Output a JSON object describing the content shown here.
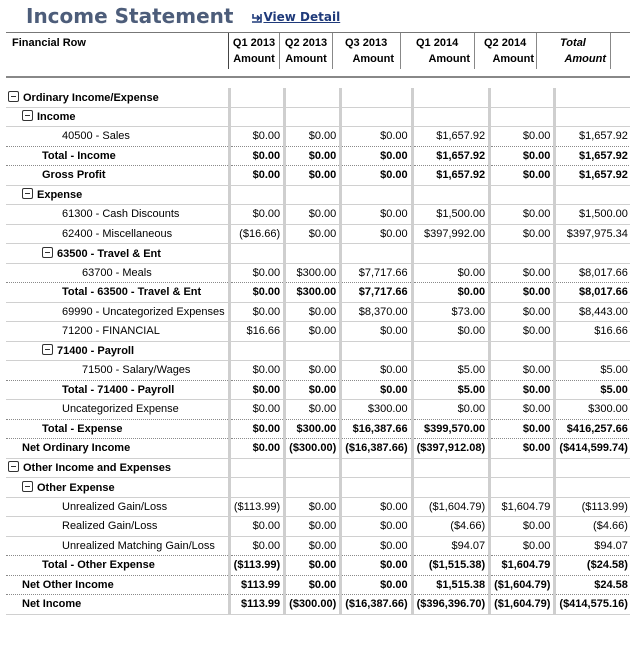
{
  "page": {
    "title": "Income Statement",
    "view_detail": "View Detail",
    "view_detail_icon": "return-arrow-icon"
  },
  "header": {
    "row_label": "Financial Row",
    "columns": [
      {
        "period": "Q1 2013",
        "sub": "Amount"
      },
      {
        "period": "Q2 2013",
        "sub": "Amount"
      },
      {
        "period": "Q3 2013",
        "sub": "Amount"
      },
      {
        "period": "Q1 2014",
        "sub": "Amount"
      },
      {
        "period": "Q2 2014",
        "sub": "Amount"
      },
      {
        "period": "Total",
        "sub": "Amount"
      }
    ]
  },
  "rows": [
    {
      "label": "Ordinary Income/Expense",
      "indent": 0,
      "type": "section",
      "collapsible": true,
      "values": [
        "",
        "",
        "",
        "",
        "",
        ""
      ]
    },
    {
      "label": "Income",
      "indent": 1,
      "type": "section",
      "collapsible": true,
      "values": [
        "",
        "",
        "",
        "",
        "",
        ""
      ]
    },
    {
      "label": "40500 - Sales",
      "indent": 3,
      "type": "item",
      "values": [
        "$0.00",
        "$0.00",
        "$0.00",
        "$1,657.92",
        "$0.00",
        "$1,657.92"
      ]
    },
    {
      "label": "Total - Income",
      "indent": 2,
      "type": "total",
      "values": [
        "$0.00",
        "$0.00",
        "$0.00",
        "$1,657.92",
        "$0.00",
        "$1,657.92"
      ]
    },
    {
      "label": "Gross Profit",
      "indent": 2,
      "type": "total",
      "values": [
        "$0.00",
        "$0.00",
        "$0.00",
        "$1,657.92",
        "$0.00",
        "$1,657.92"
      ]
    },
    {
      "label": "Expense",
      "indent": 1,
      "type": "section",
      "collapsible": true,
      "values": [
        "",
        "",
        "",
        "",
        "",
        ""
      ]
    },
    {
      "label": "61300 - Cash Discounts",
      "indent": 3,
      "type": "item",
      "values": [
        "$0.00",
        "$0.00",
        "$0.00",
        "$1,500.00",
        "$0.00",
        "$1,500.00"
      ]
    },
    {
      "label": "62400 - Miscellaneous",
      "indent": 3,
      "type": "item",
      "values": [
        "($16.66)",
        "$0.00",
        "$0.00",
        "$397,992.00",
        "$0.00",
        "$397,975.34"
      ]
    },
    {
      "label": "63500 - Travel & Ent",
      "indent": 2,
      "type": "section",
      "collapsible": true,
      "values": [
        "",
        "",
        "",
        "",
        "",
        ""
      ]
    },
    {
      "label": "63700 - Meals",
      "indent": 4,
      "type": "item",
      "values": [
        "$0.00",
        "$300.00",
        "$7,717.66",
        "$0.00",
        "$0.00",
        "$8,017.66"
      ]
    },
    {
      "label": "Total - 63500 - Travel & Ent",
      "indent": 3,
      "type": "total",
      "values": [
        "$0.00",
        "$300.00",
        "$7,717.66",
        "$0.00",
        "$0.00",
        "$8,017.66"
      ]
    },
    {
      "label": "69990 - Uncategorized Expenses",
      "indent": 3,
      "type": "item",
      "values": [
        "$0.00",
        "$0.00",
        "$8,370.00",
        "$73.00",
        "$0.00",
        "$8,443.00"
      ]
    },
    {
      "label": "71200 - FINANCIAL",
      "indent": 3,
      "type": "item",
      "values": [
        "$16.66",
        "$0.00",
        "$0.00",
        "$0.00",
        "$0.00",
        "$16.66"
      ]
    },
    {
      "label": "71400 - Payroll",
      "indent": 2,
      "type": "section",
      "collapsible": true,
      "values": [
        "",
        "",
        "",
        "",
        "",
        ""
      ]
    },
    {
      "label": "71500 - Salary/Wages",
      "indent": 4,
      "type": "item",
      "values": [
        "$0.00",
        "$0.00",
        "$0.00",
        "$5.00",
        "$0.00",
        "$5.00"
      ]
    },
    {
      "label": "Total - 71400 - Payroll",
      "indent": 3,
      "type": "total",
      "values": [
        "$0.00",
        "$0.00",
        "$0.00",
        "$5.00",
        "$0.00",
        "$5.00"
      ]
    },
    {
      "label": "Uncategorized Expense",
      "indent": 3,
      "type": "item",
      "values": [
        "$0.00",
        "$0.00",
        "$300.00",
        "$0.00",
        "$0.00",
        "$300.00"
      ]
    },
    {
      "label": "Total - Expense",
      "indent": 2,
      "type": "total",
      "values": [
        "$0.00",
        "$300.00",
        "$16,387.66",
        "$399,570.00",
        "$0.00",
        "$416,257.66"
      ]
    },
    {
      "label": "Net Ordinary Income",
      "indent": 1,
      "type": "total",
      "values": [
        "$0.00",
        "($300.00)",
        "($16,387.66)",
        "($397,912.08)",
        "$0.00",
        "($414,599.74)"
      ]
    },
    {
      "label": "Other Income and Expenses",
      "indent": 0,
      "type": "section",
      "collapsible": true,
      "values": [
        "",
        "",
        "",
        "",
        "",
        ""
      ]
    },
    {
      "label": "Other Expense",
      "indent": 1,
      "type": "section",
      "collapsible": true,
      "values": [
        "",
        "",
        "",
        "",
        "",
        ""
      ]
    },
    {
      "label": "Unrealized Gain/Loss",
      "indent": 3,
      "type": "item",
      "values": [
        "($113.99)",
        "$0.00",
        "$0.00",
        "($1,604.79)",
        "$1,604.79",
        "($113.99)"
      ]
    },
    {
      "label": "Realized Gain/Loss",
      "indent": 3,
      "type": "item",
      "values": [
        "$0.00",
        "$0.00",
        "$0.00",
        "($4.66)",
        "$0.00",
        "($4.66)"
      ]
    },
    {
      "label": "Unrealized Matching Gain/Loss",
      "indent": 3,
      "type": "item",
      "values": [
        "$0.00",
        "$0.00",
        "$0.00",
        "$94.07",
        "$0.00",
        "$94.07"
      ]
    },
    {
      "label": "Total - Other Expense",
      "indent": 2,
      "type": "total",
      "values": [
        "($113.99)",
        "$0.00",
        "$0.00",
        "($1,515.38)",
        "$1,604.79",
        "($24.58)"
      ]
    },
    {
      "label": "Net Other Income",
      "indent": 1,
      "type": "total",
      "values": [
        "$113.99",
        "$0.00",
        "$0.00",
        "$1,515.38",
        "($1,604.79)",
        "$24.58"
      ]
    },
    {
      "label": "Net Income",
      "indent": 1,
      "type": "total",
      "values": [
        "$113.99",
        "($300.00)",
        "($16,387.66)",
        "($396,396.70)",
        "($1,604.79)",
        "($414,575.16)"
      ]
    }
  ]
}
